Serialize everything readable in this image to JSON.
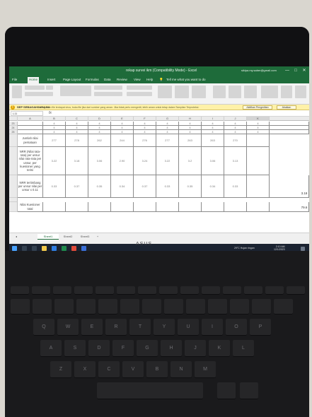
{
  "window": {
    "title": "rekap survei ikm (Compatibility Mode) - Excel",
    "account": "siklpa.my.saber@gmail.com",
    "controls": [
      "—",
      "□",
      "✕"
    ]
  },
  "menu": {
    "items": [
      "File",
      "Home",
      "Insert",
      "Page Layout",
      "Formulas",
      "Data",
      "Review",
      "View",
      "Help"
    ],
    "active_index": 1,
    "tell_me": "Tell me what you want to do"
  },
  "warning": {
    "label": "SEP SEBAGAI CARA INI",
    "text": "Kemungkinan file terdapat virus, buka file jika dari sumber yang aman. Jika tidak perlu mengedit, lebih aman untuk tetap dalam Tampilan Terproteksi.",
    "button1": "Aktifkan Pengeditan",
    "button2": "Abaikan"
  },
  "formula": {
    "namebox": "L11",
    "fx": "fx"
  },
  "grid": {
    "columns": [
      "A",
      "B",
      "C",
      "D",
      "E",
      "F",
      "G",
      "H",
      "I",
      "J",
      "K"
    ],
    "top_rows": [
      {
        "row": "23",
        "values": [
          "4",
          "4",
          "4",
          "4",
          "4",
          "4",
          "4",
          "4",
          "4",
          "4"
        ]
      },
      {
        "row": "24",
        "values": [
          "4",
          "4",
          "4",
          "4",
          "4",
          "4",
          "4",
          "4",
          "4",
          "4"
        ]
      },
      {
        "row": "25",
        "values": [
          "4",
          "4",
          "4",
          "4",
          "4",
          "4",
          "4",
          "4",
          "4",
          "4"
        ]
      }
    ],
    "jumlah_label": "Jumlah nilai persatuan",
    "jumlah_values": [
      "277",
      "278",
      "262",
      "244",
      "276",
      "277",
      "263",
      "263",
      "270"
    ],
    "nrr_label": "NRR (Nilai rata-rata) per unsur nilai rata-rata per unsur, per kuesioner yang terisi",
    "nrr_values": [
      "3.22",
      "3.18",
      "3.06",
      "2.90",
      "3.24",
      "3.22",
      "3.2",
      "3.06",
      "3.13"
    ],
    "nrr_tertimbang_label": "NRR tertimbang per unsur nilai per unsur x 0.11",
    "nrr_tertimbang_values": [
      "0.33",
      "0.37",
      "0.35",
      "0.34",
      "0.37",
      "0.33",
      "0.35",
      "0.34",
      "0.33"
    ],
    "nrr_tertimbang_total": "3.18",
    "nilai_label": "Nilai Kuesioner total",
    "nilai_value": "79.6"
  },
  "tabs": {
    "items": [
      "Sheet1",
      "Sheet2",
      "Sheet3"
    ],
    "add": "+"
  },
  "taskbar": {
    "weather": "29°C Hujan ringan",
    "time": "2:10 AM",
    "date": "12/1/2023"
  },
  "laptop": {
    "brand": "ASUS"
  },
  "keyboard": {
    "row1": [
      "Q",
      "W",
      "E",
      "R",
      "T",
      "Y",
      "U",
      "I",
      "O",
      "P"
    ],
    "row2": [
      "A",
      "S",
      "D",
      "F",
      "G",
      "H",
      "J",
      "K",
      "L"
    ],
    "row3": [
      "Z",
      "X",
      "C",
      "V",
      "B",
      "N",
      "M"
    ]
  }
}
